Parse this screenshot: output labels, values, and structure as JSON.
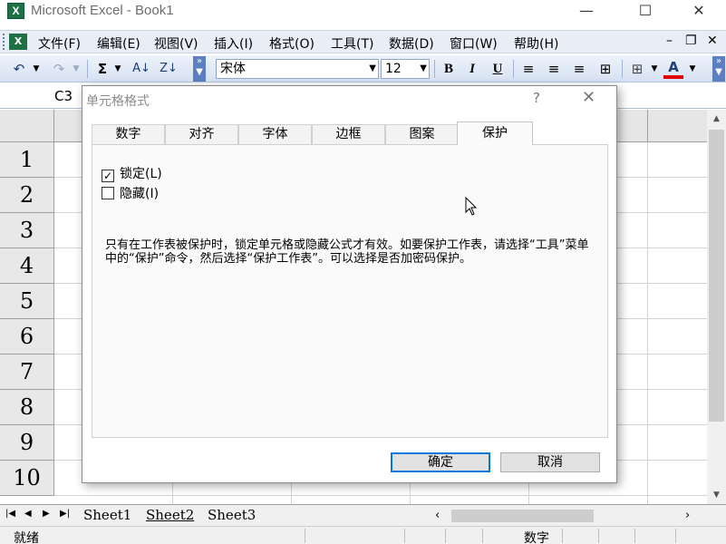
{
  "window": {
    "title": "Microsoft Excel - Book1",
    "app_icon": "X",
    "minimize": "—",
    "maximize": "☐",
    "close": "✕"
  },
  "menu": {
    "items": [
      "文件(F)",
      "编辑(E)",
      "视图(V)",
      "插入(I)",
      "格式(O)",
      "工具(T)",
      "数据(D)",
      "窗口(W)",
      "帮助(H)"
    ],
    "mdi_minimize": "–",
    "mdi_restore": "❐",
    "mdi_close": "✕"
  },
  "toolbar": {
    "undo": "↶",
    "redo": "↷",
    "autosum": "Σ",
    "sort_asc": "A↓",
    "sort_desc": "Z↓",
    "font_name": "宋体",
    "font_size": "12",
    "bold": "B",
    "italic": "I",
    "underline": "U",
    "font_color_label": "A",
    "font_color": "#e00000"
  },
  "formula_bar": {
    "name_box": "C3"
  },
  "grid": {
    "row_numbers": [
      "1",
      "2",
      "3",
      "4",
      "5",
      "6",
      "7",
      "8",
      "9",
      "10"
    ]
  },
  "sheets": {
    "tabs": [
      "Sheet1",
      "Sheet2",
      "Sheet3"
    ],
    "active": "Sheet2"
  },
  "status": {
    "ready": "就绪",
    "num_lock": "数字"
  },
  "dialog": {
    "title": "单元格格式",
    "help": "?",
    "close": "✕",
    "tabs": [
      "数字",
      "对齐",
      "字体",
      "边框",
      "图案",
      "保护"
    ],
    "active_tab": "保护",
    "locked": {
      "label": "锁定(L)",
      "checked": true,
      "mark": "✓"
    },
    "hidden": {
      "label": "隐藏(I)",
      "checked": false
    },
    "note": "只有在工作表被保护时，锁定单元格或隐藏公式才有效。如要保护工作表，请选择“工具”菜单中的“保护”命令，然后选择“保护工作表”。可以选择是否加密码保护。",
    "ok": "确定",
    "cancel": "取消"
  }
}
